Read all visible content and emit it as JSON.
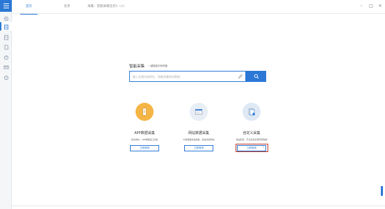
{
  "tabs": [
    {
      "label": "首页",
      "active": true
    },
    {
      "label": "任务",
      "active": false
    },
    {
      "label": "采集：智能采集任务1（+）",
      "active": false
    }
  ],
  "search": {
    "title": "智能采集",
    "subtitle": "一键智能识别采集",
    "placeholder": "输入关键词或网址，智能采集网站数据",
    "icon": "search-icon"
  },
  "cards": [
    {
      "title": "APP数据采集",
      "desc": "通过模拟，APP数据接口采集",
      "button": "立即使用",
      "icon": "mobile-app-icon",
      "color": "#f5b544"
    },
    {
      "title": "网站数据采集",
      "desc": "内置数据采集模板，快速采集网站",
      "button": "立即使用",
      "icon": "web-page-icon",
      "color": "#e8eef6"
    },
    {
      "title": "自定义采集",
      "desc": "自由配置，灵活采集任意网页数据",
      "button": "立即使用",
      "icon": "custom-doc-icon",
      "color": "#dfe9f5"
    }
  ],
  "colors": {
    "accent": "#2b78d6",
    "highlight": "#c0392b"
  }
}
